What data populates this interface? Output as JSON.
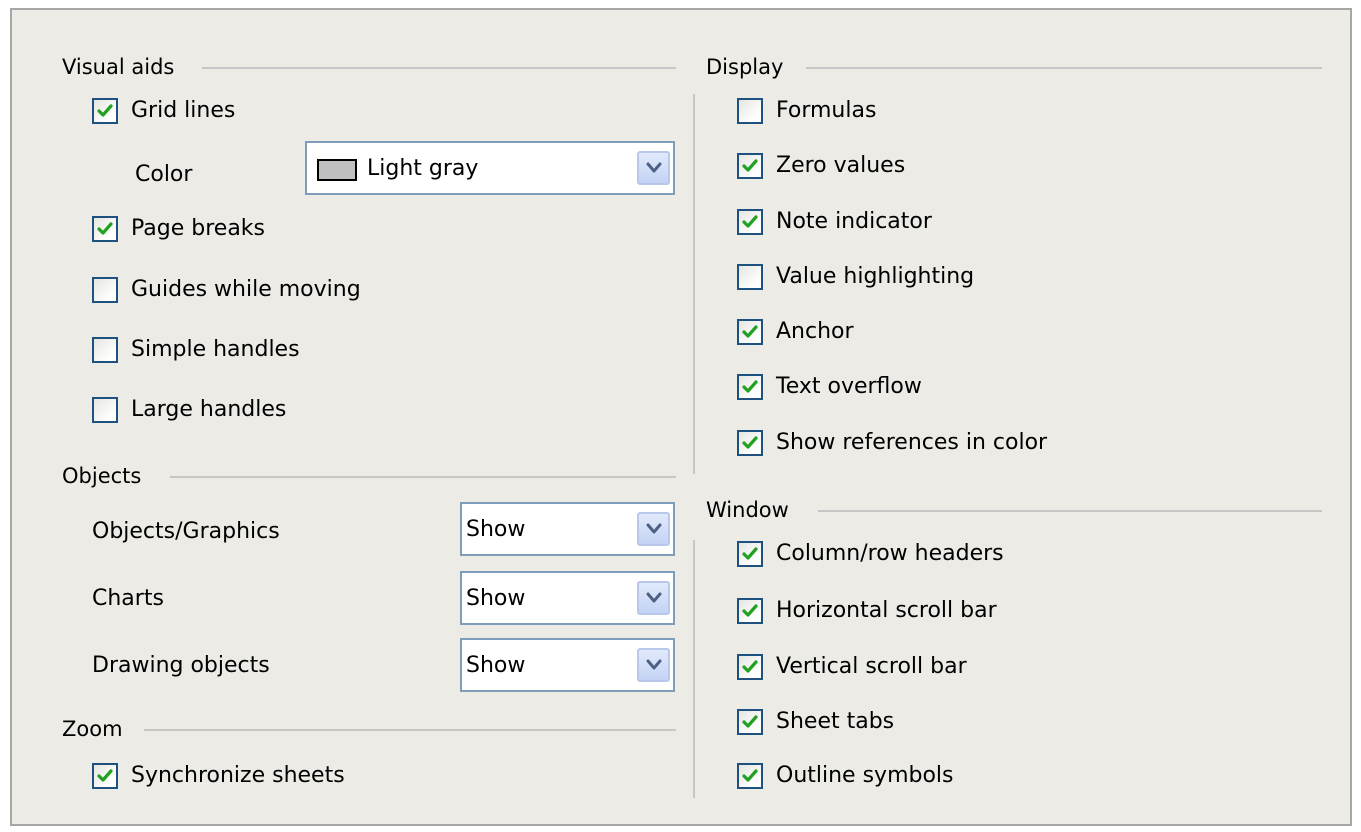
{
  "visual_aids": {
    "title": "Visual aids",
    "grid_lines": {
      "label": "Grid lines",
      "checked": true
    },
    "color": {
      "label": "Color",
      "value": "Light gray",
      "swatch": "#c0c0c0"
    },
    "page_breaks": {
      "label": "Page breaks",
      "checked": true
    },
    "guides_while_moving": {
      "label": "Guides while moving",
      "checked": false
    },
    "simple_handles": {
      "label": "Simple handles",
      "checked": false
    },
    "large_handles": {
      "label": "Large handles",
      "checked": false
    }
  },
  "objects": {
    "title": "Objects",
    "objects_graphics": {
      "label": "Objects/Graphics",
      "value": "Show"
    },
    "charts": {
      "label": "Charts",
      "value": "Show"
    },
    "drawing_objects": {
      "label": "Drawing objects",
      "value": "Show"
    }
  },
  "zoom": {
    "title": "Zoom",
    "synchronize_sheets": {
      "label": "Synchronize sheets",
      "checked": true
    }
  },
  "display": {
    "title": "Display",
    "items": [
      {
        "label": "Formulas",
        "checked": false
      },
      {
        "label": "Zero values",
        "checked": true
      },
      {
        "label": "Note indicator",
        "checked": true
      },
      {
        "label": "Value highlighting",
        "checked": false
      },
      {
        "label": "Anchor",
        "checked": true
      },
      {
        "label": "Text overflow",
        "checked": true
      },
      {
        "label": "Show references in color",
        "checked": true
      }
    ]
  },
  "window": {
    "title": "Window",
    "items": [
      {
        "label": "Column/row headers",
        "checked": true
      },
      {
        "label": "Horizontal scroll bar",
        "checked": true
      },
      {
        "label": "Vertical scroll bar",
        "checked": true
      },
      {
        "label": "Sheet tabs",
        "checked": true
      },
      {
        "label": "Outline symbols",
        "checked": true
      }
    ]
  },
  "colors": {
    "check_mark": "#21a121",
    "checkbox_border": "#1c5180",
    "dialog_bg": "#ecebe6"
  }
}
